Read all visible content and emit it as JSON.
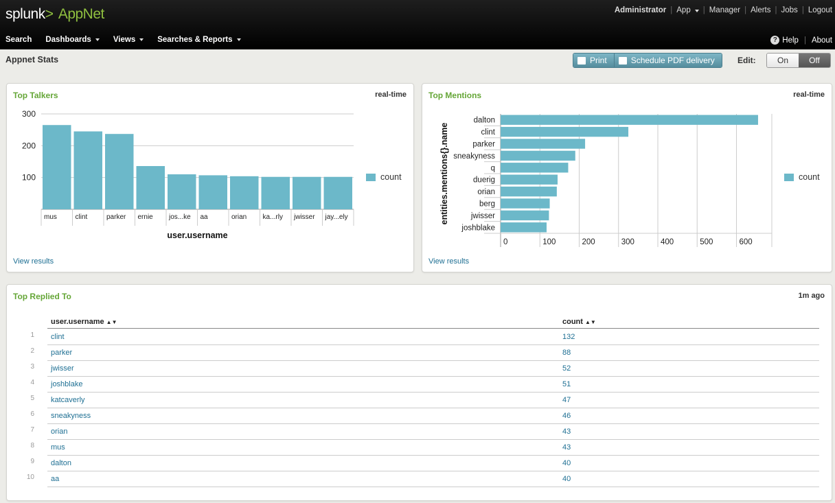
{
  "header": {
    "logo": {
      "brand": "splunk",
      "sep": ">",
      "app": "AppNet"
    },
    "user_nav": [
      "Administrator",
      "App",
      "Manager",
      "Alerts",
      "Jobs",
      "Logout"
    ],
    "main_nav": [
      "Search",
      "Dashboards",
      "Views",
      "Searches & Reports"
    ],
    "help": "Help",
    "about": "About"
  },
  "page": {
    "title": "Appnet Stats",
    "print": "Print",
    "schedule": "Schedule PDF delivery",
    "edit_label": "Edit:",
    "edit_on": "On",
    "edit_off": "Off"
  },
  "panels": {
    "top_talkers": {
      "title": "Top Talkers",
      "meta": "real-time",
      "link": "View results",
      "legend": "count"
    },
    "top_mentions": {
      "title": "Top Mentions",
      "meta": "real-time",
      "link": "View results",
      "legend": "count"
    },
    "top_replied": {
      "title": "Top Replied To",
      "meta": "1m ago"
    }
  },
  "chart_data": [
    {
      "type": "bar",
      "title": "Top Talkers",
      "xlabel": "user.username",
      "ylabel": "",
      "categories": [
        "mus",
        "clint",
        "parker",
        "ernie",
        "jos...ke",
        "aa",
        "orian",
        "ka...rly",
        "jwisser",
        "jay...ely"
      ],
      "series": [
        {
          "name": "count",
          "values": [
            265,
            245,
            237,
            136,
            110,
            107,
            104,
            102,
            102,
            102
          ]
        }
      ],
      "ylim": [
        0,
        300
      ],
      "yticks": [
        100,
        200,
        300
      ],
      "grid": true,
      "legend": "right",
      "color": "#6cb8c9"
    },
    {
      "type": "bar",
      "orientation": "horizontal",
      "title": "Top Mentions",
      "xlabel": "",
      "ylabel": "entities.mentions{}.name",
      "categories": [
        "dalton",
        "clint",
        "parker",
        "sneakyness",
        "q",
        "duerig",
        "orian",
        "berg",
        "jwisser",
        "joshblake"
      ],
      "series": [
        {
          "name": "count",
          "values": [
            655,
            325,
            215,
            190,
            172,
            145,
            143,
            125,
            123,
            117
          ]
        }
      ],
      "xlim": [
        0,
        690
      ],
      "xticks": [
        0,
        100,
        200,
        300,
        400,
        500,
        600
      ],
      "grid": true,
      "legend": "right",
      "color": "#6cb8c9"
    }
  ],
  "table": {
    "columns": [
      "user.username",
      "count"
    ],
    "rows": [
      {
        "num": "1",
        "user": "clint",
        "count": "132"
      },
      {
        "num": "2",
        "user": "parker",
        "count": "88"
      },
      {
        "num": "3",
        "user": "jwisser",
        "count": "52"
      },
      {
        "num": "4",
        "user": "joshblake",
        "count": "51"
      },
      {
        "num": "5",
        "user": "katcaverly",
        "count": "47"
      },
      {
        "num": "6",
        "user": "sneakyness",
        "count": "46"
      },
      {
        "num": "7",
        "user": "orian",
        "count": "43"
      },
      {
        "num": "8",
        "user": "mus",
        "count": "43"
      },
      {
        "num": "9",
        "user": "dalton",
        "count": "40"
      },
      {
        "num": "10",
        "user": "aa",
        "count": "40"
      }
    ]
  }
}
